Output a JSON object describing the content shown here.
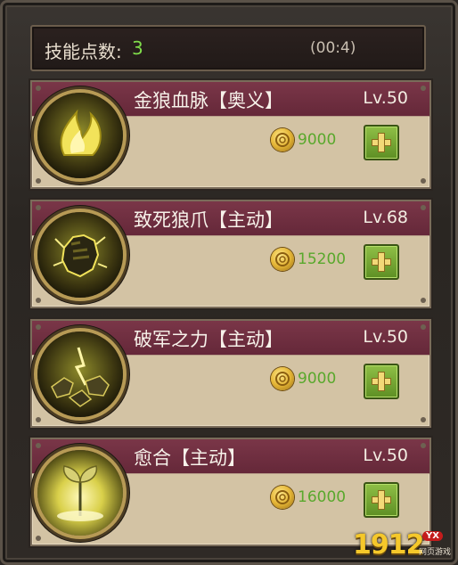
{
  "header": {
    "skill_points_label": "技能点数:",
    "skill_points_value": "3",
    "timer": "(00:4)"
  },
  "skills": [
    {
      "name": "金狼血脉【奥义】",
      "level": "Lv.50",
      "cost": "9000",
      "icon": "golden-flame-icon"
    },
    {
      "name": "致死狼爪【主动】",
      "level": "Lv.68",
      "cost": "15200",
      "icon": "clenched-fist-icon"
    },
    {
      "name": "破军之力【主动】",
      "level": "Lv.50",
      "cost": "9000",
      "icon": "shattered-rock-icon"
    },
    {
      "name": "愈合【主动】",
      "level": "Lv.50",
      "cost": "16000",
      "icon": "healing-leaf-icon"
    }
  ],
  "watermark": {
    "brand": "1912",
    "tag": "YX",
    "subtitle": "网页游戏"
  },
  "colors": {
    "band": "#6e2d40",
    "card": "#d3c3a4",
    "cost": "#59a82c",
    "points": "#7fdc4a"
  }
}
